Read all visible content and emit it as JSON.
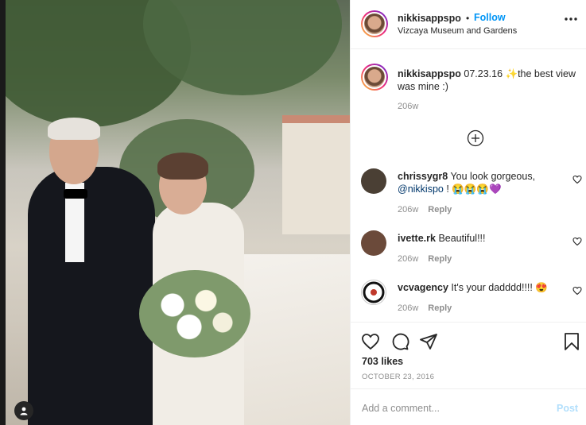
{
  "post": {
    "username": "nikkisappspo",
    "dot": "•",
    "follow_label": "Follow",
    "location": "Vizcaya Museum and Gardens",
    "more_icon": "more-horizontal-icon"
  },
  "caption": {
    "username": "nikkisappspo",
    "text": "07.23.16 ✨the best view was mine :)",
    "time": "206w"
  },
  "load_more_icon": "plus-circle-icon",
  "comments": [
    {
      "username": "chrissygr8",
      "text": "You look gorgeous,",
      "mention": "@nikkispo",
      "text_after": "! 😭😭😭💜",
      "time": "206w",
      "reply_label": "Reply",
      "avatar_color": "#4a3f34"
    },
    {
      "username": "ivette.rk",
      "text": "Beautiful!!!",
      "time": "206w",
      "reply_label": "Reply",
      "avatar_color": "#6b4a3a"
    },
    {
      "username": "vcvagency",
      "text": "It's your dadddd!!!! 😍",
      "time": "206w",
      "reply_label": "Reply",
      "avatar_color": "#ffffff"
    }
  ],
  "actions": {
    "likes": "703 likes",
    "date": "OCTOBER 23, 2016",
    "icons": [
      "heart-icon",
      "comment-icon",
      "share-icon",
      "bookmark-icon"
    ]
  },
  "add_comment": {
    "placeholder": "Add a comment...",
    "post_label": "Post"
  },
  "colors": {
    "accent": "#0095f6",
    "post_disabled": "#b2dffc",
    "muted": "#8e8e8e"
  }
}
